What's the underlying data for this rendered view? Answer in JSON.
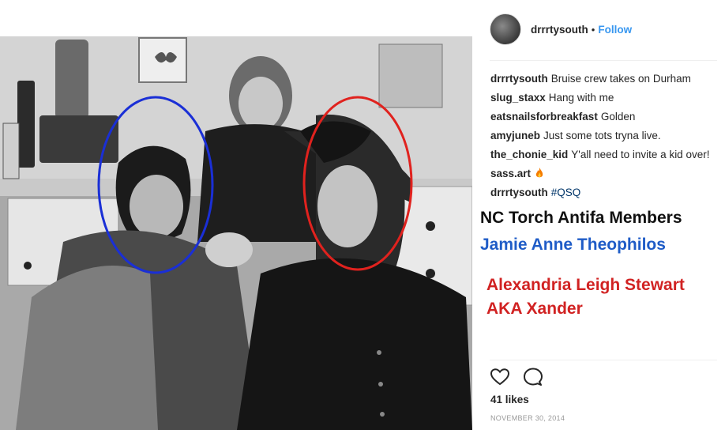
{
  "post": {
    "username": "drrrtysouth",
    "dot": "•",
    "follow_label": "Follow",
    "likes": "41 likes",
    "date": "NOVEMBER 30, 2014"
  },
  "comments": [
    {
      "author": "drrrtysouth",
      "text": "Bruise crew takes on Durham"
    },
    {
      "author": "slug_staxx",
      "text": "Hang with me"
    },
    {
      "author": "eatsnailsforbreakfast",
      "text": "Golden"
    },
    {
      "author": "amyjuneb",
      "text": "Just some tots tryna live."
    },
    {
      "author": "the_chonie_kid",
      "text": "Y'all need to invite a kid over!"
    },
    {
      "author": "sass.art",
      "text": ""
    },
    {
      "author": "drrrtysouth",
      "text": "#QSQ"
    }
  ],
  "overlay": {
    "heading": "NC Torch Antifa Members",
    "name_blue": "Jamie Anne Theophilos",
    "name_red_line1": "Alexandria Leigh Stewart",
    "name_red_line2": "AKA Xander"
  },
  "icons": {
    "like": "heart-icon",
    "comment": "speech-bubble-icon",
    "emoji": "fire-icon"
  },
  "colors": {
    "follow": "#3897f0",
    "hashtag": "#003569",
    "blue_label": "#1f5cc7",
    "red_label": "#d12222",
    "blue_circle": "#1a2fd6",
    "red_circle": "#e0221e"
  }
}
